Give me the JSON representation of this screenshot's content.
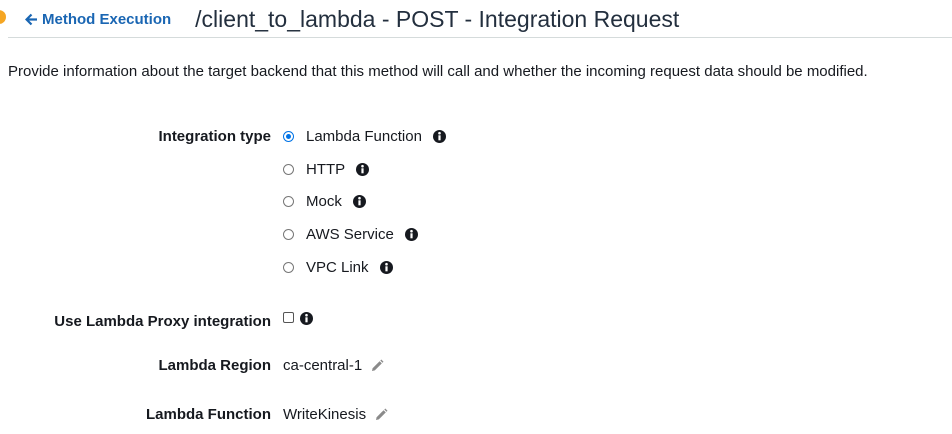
{
  "header": {
    "back_label": "Method Execution",
    "title": "/client_to_lambda - POST - Integration Request"
  },
  "description": "Provide information about the target backend that this method will call and whether the incoming request data should be modified.",
  "integration_type": {
    "label": "Integration type",
    "selected": "Lambda Function",
    "options": [
      {
        "label": "Lambda Function",
        "checked": true
      },
      {
        "label": "HTTP",
        "checked": false
      },
      {
        "label": "Mock",
        "checked": false
      },
      {
        "label": "AWS Service",
        "checked": false
      },
      {
        "label": "VPC Link",
        "checked": false
      }
    ]
  },
  "proxy": {
    "label": "Use Lambda Proxy integration",
    "checked": false
  },
  "region": {
    "label": "Lambda Region",
    "value": "ca-central-1"
  },
  "function": {
    "label": "Lambda Function",
    "value": "WriteKinesis"
  },
  "colors": {
    "link": "#1a66b3",
    "radio_selected": "#0073e6",
    "accent_dot": "#f5a623"
  },
  "icons": [
    "arrow-left-icon",
    "info-icon",
    "pencil-icon"
  ]
}
